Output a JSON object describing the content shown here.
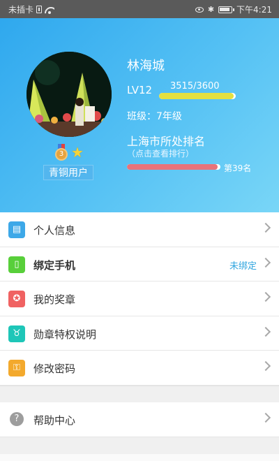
{
  "status_bar": {
    "carrier": "未插卡",
    "time": "下午4:21"
  },
  "profile": {
    "name": "林海城",
    "level": "LV12",
    "xp_text": "3515/3600",
    "xp_progress": 0.976,
    "grade": "班级：7年级",
    "badge": "青铜用户",
    "rank_title": "上海市所处排名",
    "rank_hint": "（点击查看排行）",
    "rank_progress": 0.97,
    "rank_value": "第39名"
  },
  "menu": {
    "items": [
      {
        "label": "个人信息",
        "icon": "id-card-icon",
        "color": "#3da8e8"
      },
      {
        "label": "绑定手机",
        "icon": "phone-icon",
        "color": "#58cf3a",
        "value": "未绑定"
      },
      {
        "label": "我的奖章",
        "icon": "medal-icon",
        "color": "#f06262"
      },
      {
        "label": "勋章特权说明",
        "icon": "badge-icon",
        "color": "#1ec6b8"
      },
      {
        "label": "修改密码",
        "icon": "lock-icon",
        "color": "#f3a92d"
      }
    ],
    "help_label": "帮助中心"
  },
  "colors": {
    "header_start": "#2fa8ee",
    "xp_fill": "#e4e040",
    "rank_fill": "#e8737a",
    "accent": "#31a6df"
  }
}
